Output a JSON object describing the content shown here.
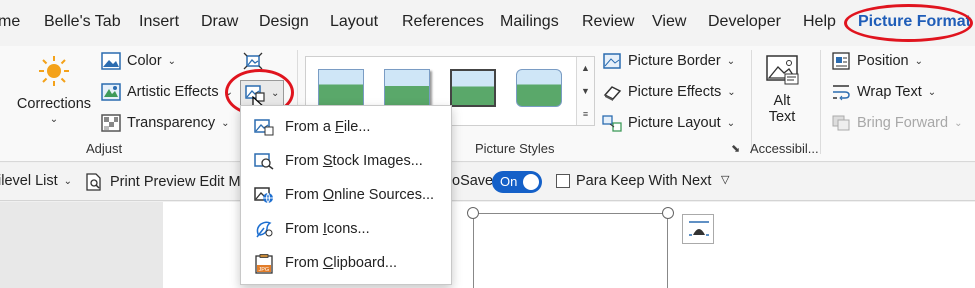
{
  "tabs": [
    {
      "id": "home",
      "label": "me"
    },
    {
      "id": "belles",
      "label": "Belle's Tab"
    },
    {
      "id": "insert",
      "label": "Insert"
    },
    {
      "id": "draw",
      "label": "Draw"
    },
    {
      "id": "design",
      "label": "Design"
    },
    {
      "id": "layout",
      "label": "Layout"
    },
    {
      "id": "references",
      "label": "References"
    },
    {
      "id": "mailings",
      "label": "Mailings"
    },
    {
      "id": "review",
      "label": "Review"
    },
    {
      "id": "view",
      "label": "View"
    },
    {
      "id": "developer",
      "label": "Developer"
    },
    {
      "id": "help",
      "label": "Help"
    },
    {
      "id": "picture_format",
      "label": "Picture Format"
    }
  ],
  "adjust": {
    "corrections": "Corrections",
    "color": "Color",
    "artistic_effects": "Artistic Effects",
    "transparency": "Transparency",
    "group_label": "Adjust"
  },
  "picture_styles": {
    "group_label": "Picture Styles",
    "border": "Picture Border",
    "effects": "Picture Effects",
    "layout": "Picture Layout"
  },
  "accessibility": {
    "alt_text_line1": "Alt",
    "alt_text_line2": "Text",
    "group_label": "Accessibil..."
  },
  "arrange": {
    "position": "Position",
    "wrap_text": "Wrap Text",
    "bring_forward": "Bring Forward"
  },
  "quickbar": {
    "multilevel": "ilevel List",
    "print_preview": "Print Preview Edit Mo",
    "autosave_partial": "oSave",
    "toggle_state": "On",
    "para_keep": "Para Keep With Next"
  },
  "change_picture_menu": {
    "items": [
      {
        "before": "From a ",
        "key": "F",
        "after": "ile..."
      },
      {
        "before": "From ",
        "key": "S",
        "after": "tock Images..."
      },
      {
        "before": "From ",
        "key": "O",
        "after": "nline Sources..."
      },
      {
        "before": "From ",
        "key": "I",
        "after": "cons..."
      },
      {
        "before": "From ",
        "key": "C",
        "after": "lipboard..."
      }
    ],
    "icons": [
      "file-picture-icon",
      "stock-images-icon",
      "online-sources-icon",
      "icons-icon",
      "clipboard-picture-icon"
    ]
  },
  "colors": {
    "accent": "#1f5db8",
    "highlight_ring": "#e0141e",
    "toggle_on": "#1460c8"
  }
}
